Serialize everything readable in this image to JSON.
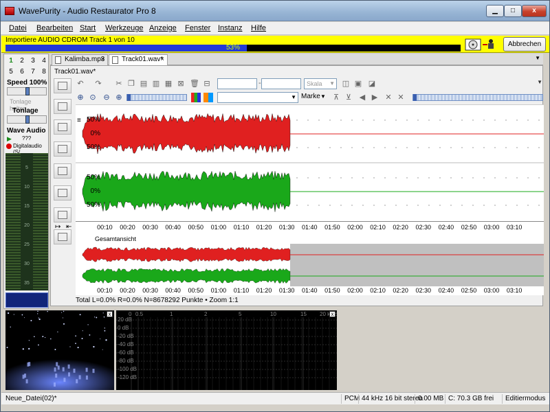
{
  "window": {
    "title": "WavePurity - Audio Restaurator Pro 8",
    "min_label": "▁",
    "max_label": "□",
    "close_label": "x"
  },
  "menu": [
    "Datei",
    "Bearbeiten",
    "Start",
    "Werkzeuge",
    "Anzeige",
    "Fenster",
    "Instanz",
    "Hilfe"
  ],
  "progress": {
    "label": "Importiere AUDIO CDROM Track 1 von 10",
    "percent": 53,
    "percent_label": "53%",
    "abort_label": "Abbrechen"
  },
  "left": {
    "numbers": [
      "1",
      "2",
      "3",
      "4",
      "5",
      "6",
      "7",
      "8"
    ],
    "speed_label": "Speed 100%",
    "pitch_hold_label": "Tonlage halten",
    "pitch_label": "Tonlage",
    "wave_audio_label": "Wave Audio",
    "wave_audio_value": "???",
    "digital_label": "Digitalaudio (S/",
    "vu_marks": [
      "5",
      "10",
      "15",
      "20",
      "25",
      "30",
      "35"
    ]
  },
  "tabs": [
    {
      "label": "Kalimba.mp3",
      "close": "×"
    },
    {
      "label": "Track01.wav*",
      "close": "×"
    }
  ],
  "doc": {
    "filename": "Track01.wav*",
    "skala_label": "Skala",
    "marke_label": "Marke"
  },
  "tracks": [
    {
      "labels": [
        "50%",
        "0%",
        "50%"
      ],
      "color": "#e02020"
    },
    {
      "labels": [
        "50%",
        "0%",
        "50%"
      ],
      "color": "#1aa81a"
    }
  ],
  "timeline": [
    "00:10",
    "00:20",
    "00:30",
    "00:40",
    "00:50",
    "01:00",
    "01:10",
    "01:20",
    "01:30",
    "01:40",
    "01:50",
    "02:00",
    "02:10",
    "02:20",
    "02:30",
    "02:40",
    "02:50",
    "03:00",
    "03:10"
  ],
  "overview": {
    "label": "Gesamtansicht"
  },
  "wave_status": "Total L=0.0% R=0.0% N=8678292 Punkte • Zoom 1:1",
  "spectrum": {
    "x_labels": [
      "0",
      "0.5",
      "1",
      "2",
      "5",
      "10",
      "15",
      "20 kHz"
    ],
    "y_labels": [
      "20 dB",
      "0 dB",
      "-20 dB",
      "-40 dB",
      "-60 dB",
      "-80 dB",
      "-100 dB",
      "-120 dB"
    ],
    "close": "x"
  },
  "statusbar": {
    "doc": "Neue_Datei(02)*",
    "format": "PCM",
    "rate": "44 kHz 16 bit stereo",
    "size": "0.00 MB",
    "free": "C: 70.3 GB frei",
    "mode": "Editiermodus"
  }
}
